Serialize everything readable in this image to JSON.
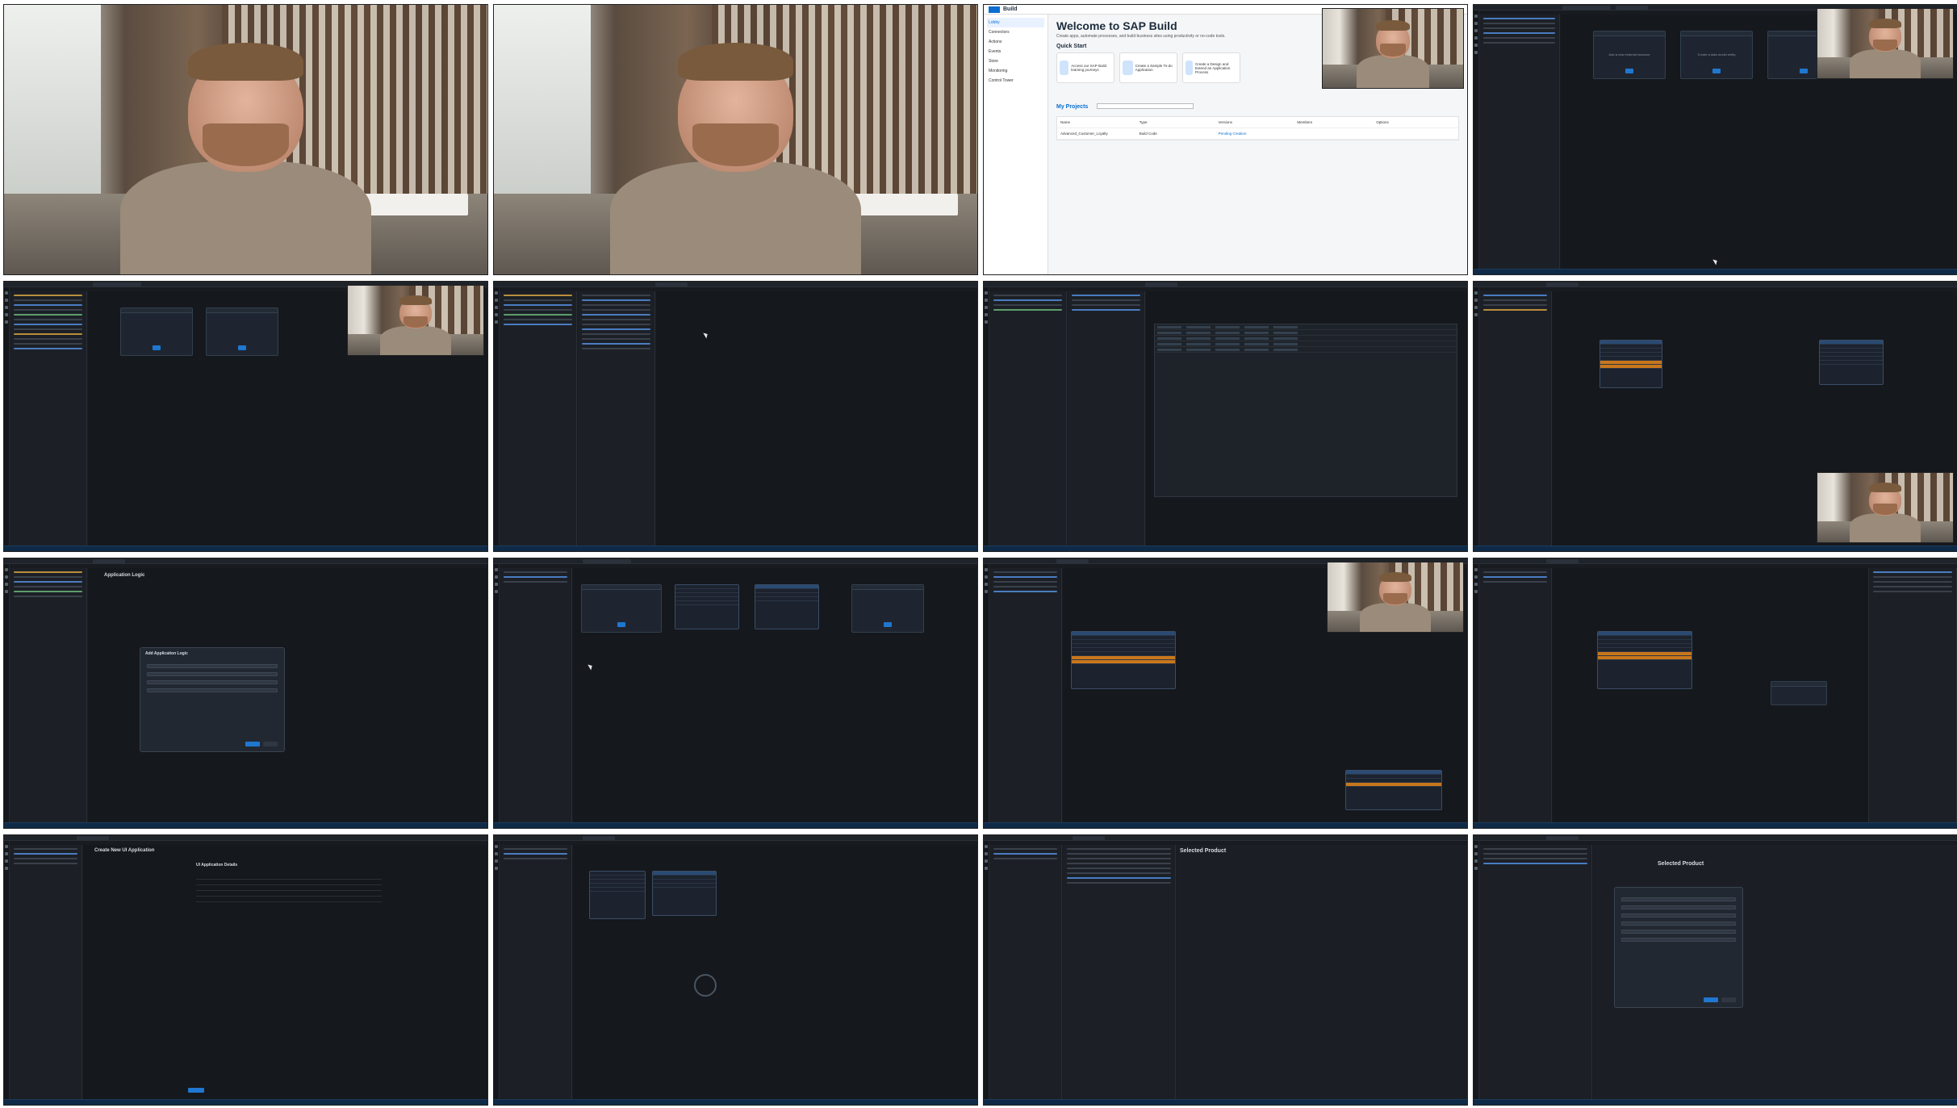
{
  "sap": {
    "brand": "Build",
    "title": "Welcome to SAP Build",
    "subtitle": "Create apps, automate processes, and build business sites using productivity or no-code tools.",
    "quick_start": "Quick Start",
    "cards": [
      "Access our SAP Build learning journeys",
      "Create a Sample To-do Application",
      "Create a Design and Extend an Application Process"
    ],
    "sidebar": [
      "Lobby",
      "Connectors",
      "Actions",
      "Events",
      "Store",
      "Monitoring",
      "Control Tower"
    ],
    "projects_heading": "My Projects",
    "search_placeholder": "Search by Project name and description",
    "columns": [
      "Name",
      "Type",
      "Versions",
      "Members",
      "Options"
    ],
    "project_row": [
      "Advanced_Customer_Loyalty",
      "Build Code",
      "Pending Creation"
    ]
  },
  "ide": {
    "nodes": [
      "Data Model",
      "Services",
      "Add a new external resource",
      "Create a data model entity",
      "Application"
    ],
    "dialog_title": "Add Application Logic",
    "create_ui_title": "Create New UI Application",
    "ui_details_title": "UI Application Details",
    "selected_product": "Selected Product"
  }
}
